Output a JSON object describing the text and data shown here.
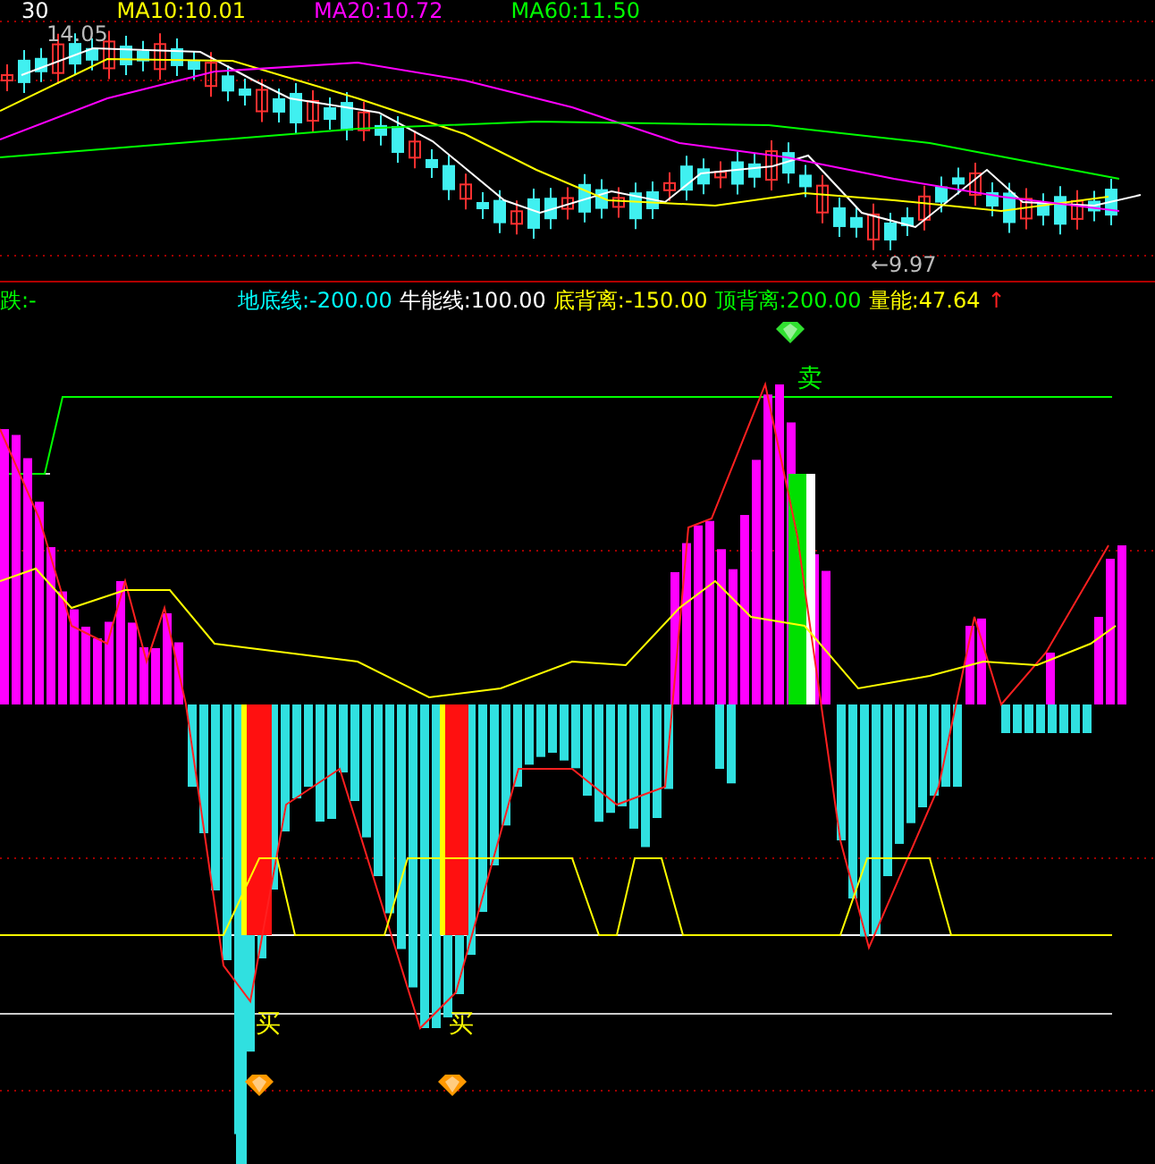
{
  "price_panel": {
    "legend": [
      {
        "text": "30",
        "color": "#ffffff"
      },
      {
        "text": "MA10:10.01",
        "color": "#ffff00"
      },
      {
        "text": "MA20:10.72",
        "color": "#ff00ff"
      },
      {
        "text": "MA60:11.50",
        "color": "#00ff00"
      }
    ],
    "high_label": "14.05",
    "low_label": "←9.97"
  },
  "indicator_panel": {
    "legend": [
      {
        "text": "跌:-",
        "color": "#00ff00"
      },
      {
        "text": "地底线:-200.00",
        "color": "#00ffff"
      },
      {
        "text": "牛能线:100.00",
        "color": "#ffffff"
      },
      {
        "text": "底背离:-150.00",
        "color": "#ffff00"
      },
      {
        "text": "顶背离:200.00",
        "color": "#00ff00"
      },
      {
        "text": "量能:47.64",
        "color": "#ffff00"
      },
      {
        "text": "↑",
        "color": "#ff2020"
      }
    ],
    "signals": [
      {
        "kind": "sell",
        "text": "卖"
      },
      {
        "kind": "buy",
        "text": "买"
      },
      {
        "kind": "buy",
        "text": "买"
      }
    ]
  }
}
